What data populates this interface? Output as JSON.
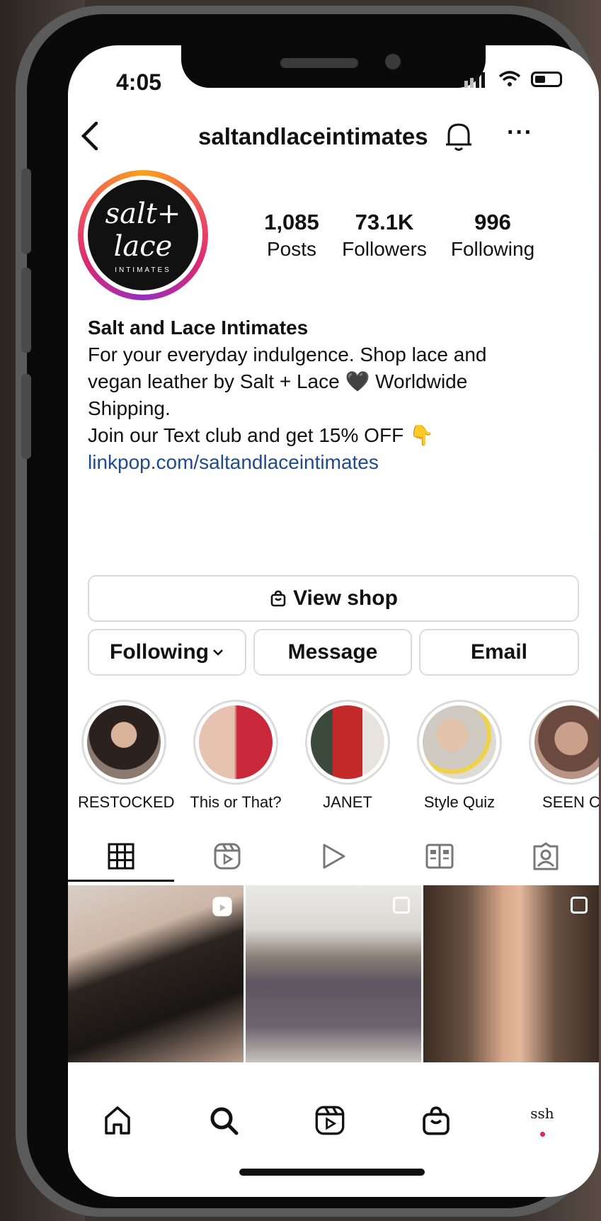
{
  "status": {
    "time": "4:05"
  },
  "profile": {
    "handle": "saltandlaceintimates",
    "logo_lines": [
      "salt+",
      "lace",
      "INTIMATES"
    ],
    "stats": [
      {
        "value": "1,085",
        "label": "Posts"
      },
      {
        "value": "73.1K",
        "label": "Followers"
      },
      {
        "value": "996",
        "label": "Following"
      }
    ],
    "name": "Salt and Lace Intimates",
    "bio_lines": [
      "For your everyday indulgence. Shop lace and",
      "vegan leather by Salt + Lace 🖤 Worldwide",
      "Shipping.",
      "Join our Text club and get 15% OFF 👇"
    ],
    "link": "linkpop.com/saltandlaceintimates"
  },
  "actions": {
    "view_shop": "View shop",
    "following": "Following",
    "message": "Message",
    "email": "Email"
  },
  "highlights": [
    "RESTOCKED",
    "This or That?",
    "JANET",
    "Style Quiz",
    "SEEN C"
  ],
  "nav": {
    "profile_label": "ssh"
  },
  "colors": {
    "link": "#1f4b8a",
    "border": "#dbdbdb",
    "text": "#111111"
  }
}
